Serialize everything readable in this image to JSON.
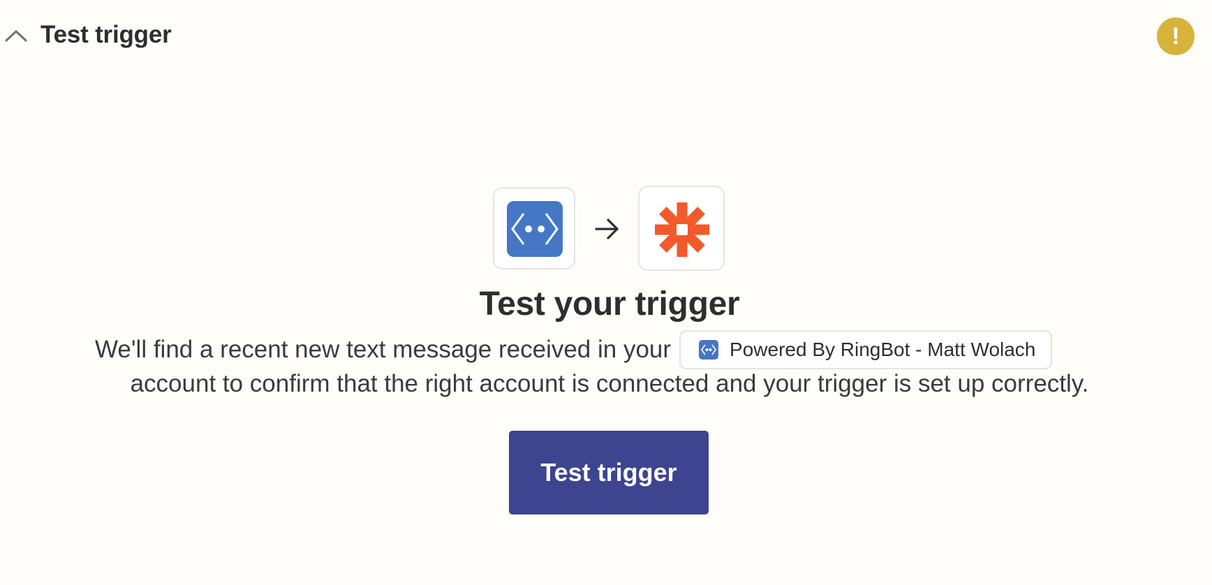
{
  "header": {
    "title": "Test trigger",
    "collapse_icon": "chevron-up-icon",
    "warning_icon": "exclamation-icon",
    "warning_glyph": "!",
    "warning_color": "#d7b33a"
  },
  "apps": {
    "source_app_icon": "ringbot-icon",
    "arrow_icon": "arrow-right-icon",
    "destination_app_icon": "zapier-icon",
    "source_color": "#4577c4",
    "destination_color": "#f15a2b"
  },
  "main": {
    "headline": "Test your trigger",
    "description_before": "We'll find a recent new text message received in your",
    "account_name": "Powered By RingBot - Matt Wolach",
    "description_after": "account to confirm that the right account is connected and your trigger is set up correctly.",
    "button_label": "Test trigger",
    "button_color": "#3d4490"
  }
}
